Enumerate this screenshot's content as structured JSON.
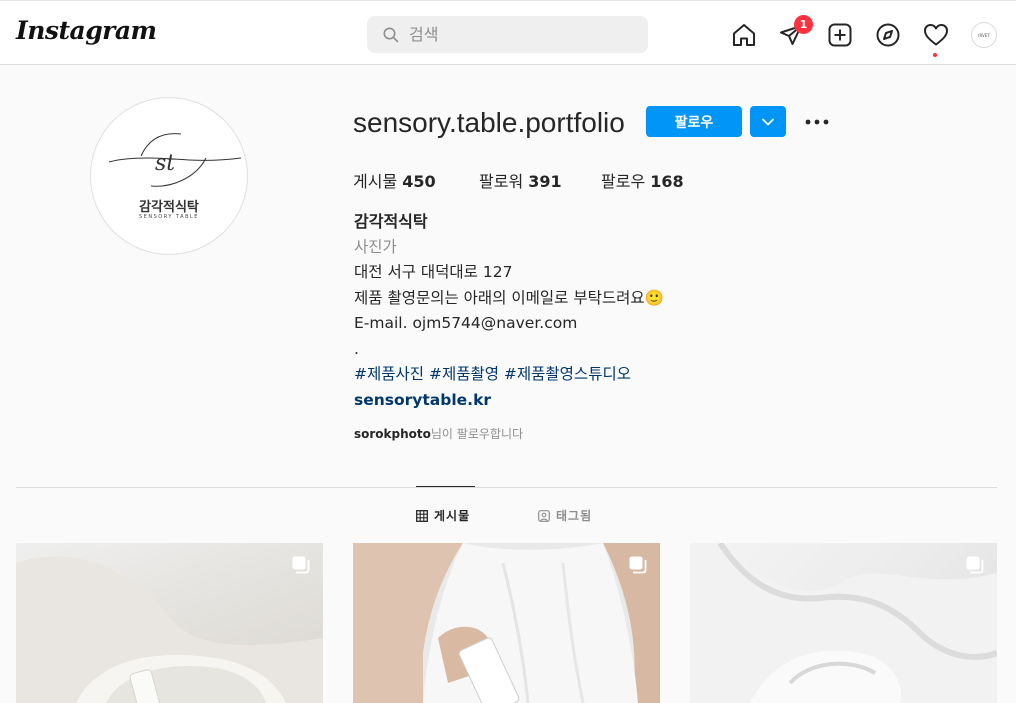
{
  "nav": {
    "logo": "Instagram",
    "search_placeholder": "검색",
    "direct_badge": "1",
    "avatar_text": "IRVET",
    "icons": [
      "home-icon",
      "direct-icon",
      "new-post-icon",
      "explore-icon",
      "heart-icon"
    ]
  },
  "profile": {
    "pic_title": "감각적식탁",
    "pic_subtitle": "SENSORY TABLE",
    "pic_monogram": "st",
    "username": "sensory.table.portfolio",
    "follow_label": "팔로우",
    "stats": [
      {
        "label": "게시물",
        "value": "450"
      },
      {
        "label": "팔로워",
        "value": "391"
      },
      {
        "label": "팔로우",
        "value": "168"
      }
    ],
    "bio": {
      "name": "감각적식탁",
      "category": "사진가",
      "address": "대전 서구 대덕대로 127",
      "inquiry": "제품 촬영문의는 아래의 이메일로 부탁드려요🙂",
      "email": "E-mail. ojm5744@naver.com",
      "dot": ".",
      "hashtags": "#제품사진 #제품촬영 #제품촬영스튜디오",
      "website": "sensorytable.kr"
    },
    "followed_by_user": "sorokphoto",
    "followed_by_suffix": "님이 팔로우합니다"
  },
  "tabs": [
    {
      "label": "게시물",
      "active": true
    },
    {
      "label": "태그됨",
      "active": false
    }
  ],
  "colors": {
    "accent": "#0095f6",
    "badge": "#ff3040",
    "link": "#00376b"
  }
}
